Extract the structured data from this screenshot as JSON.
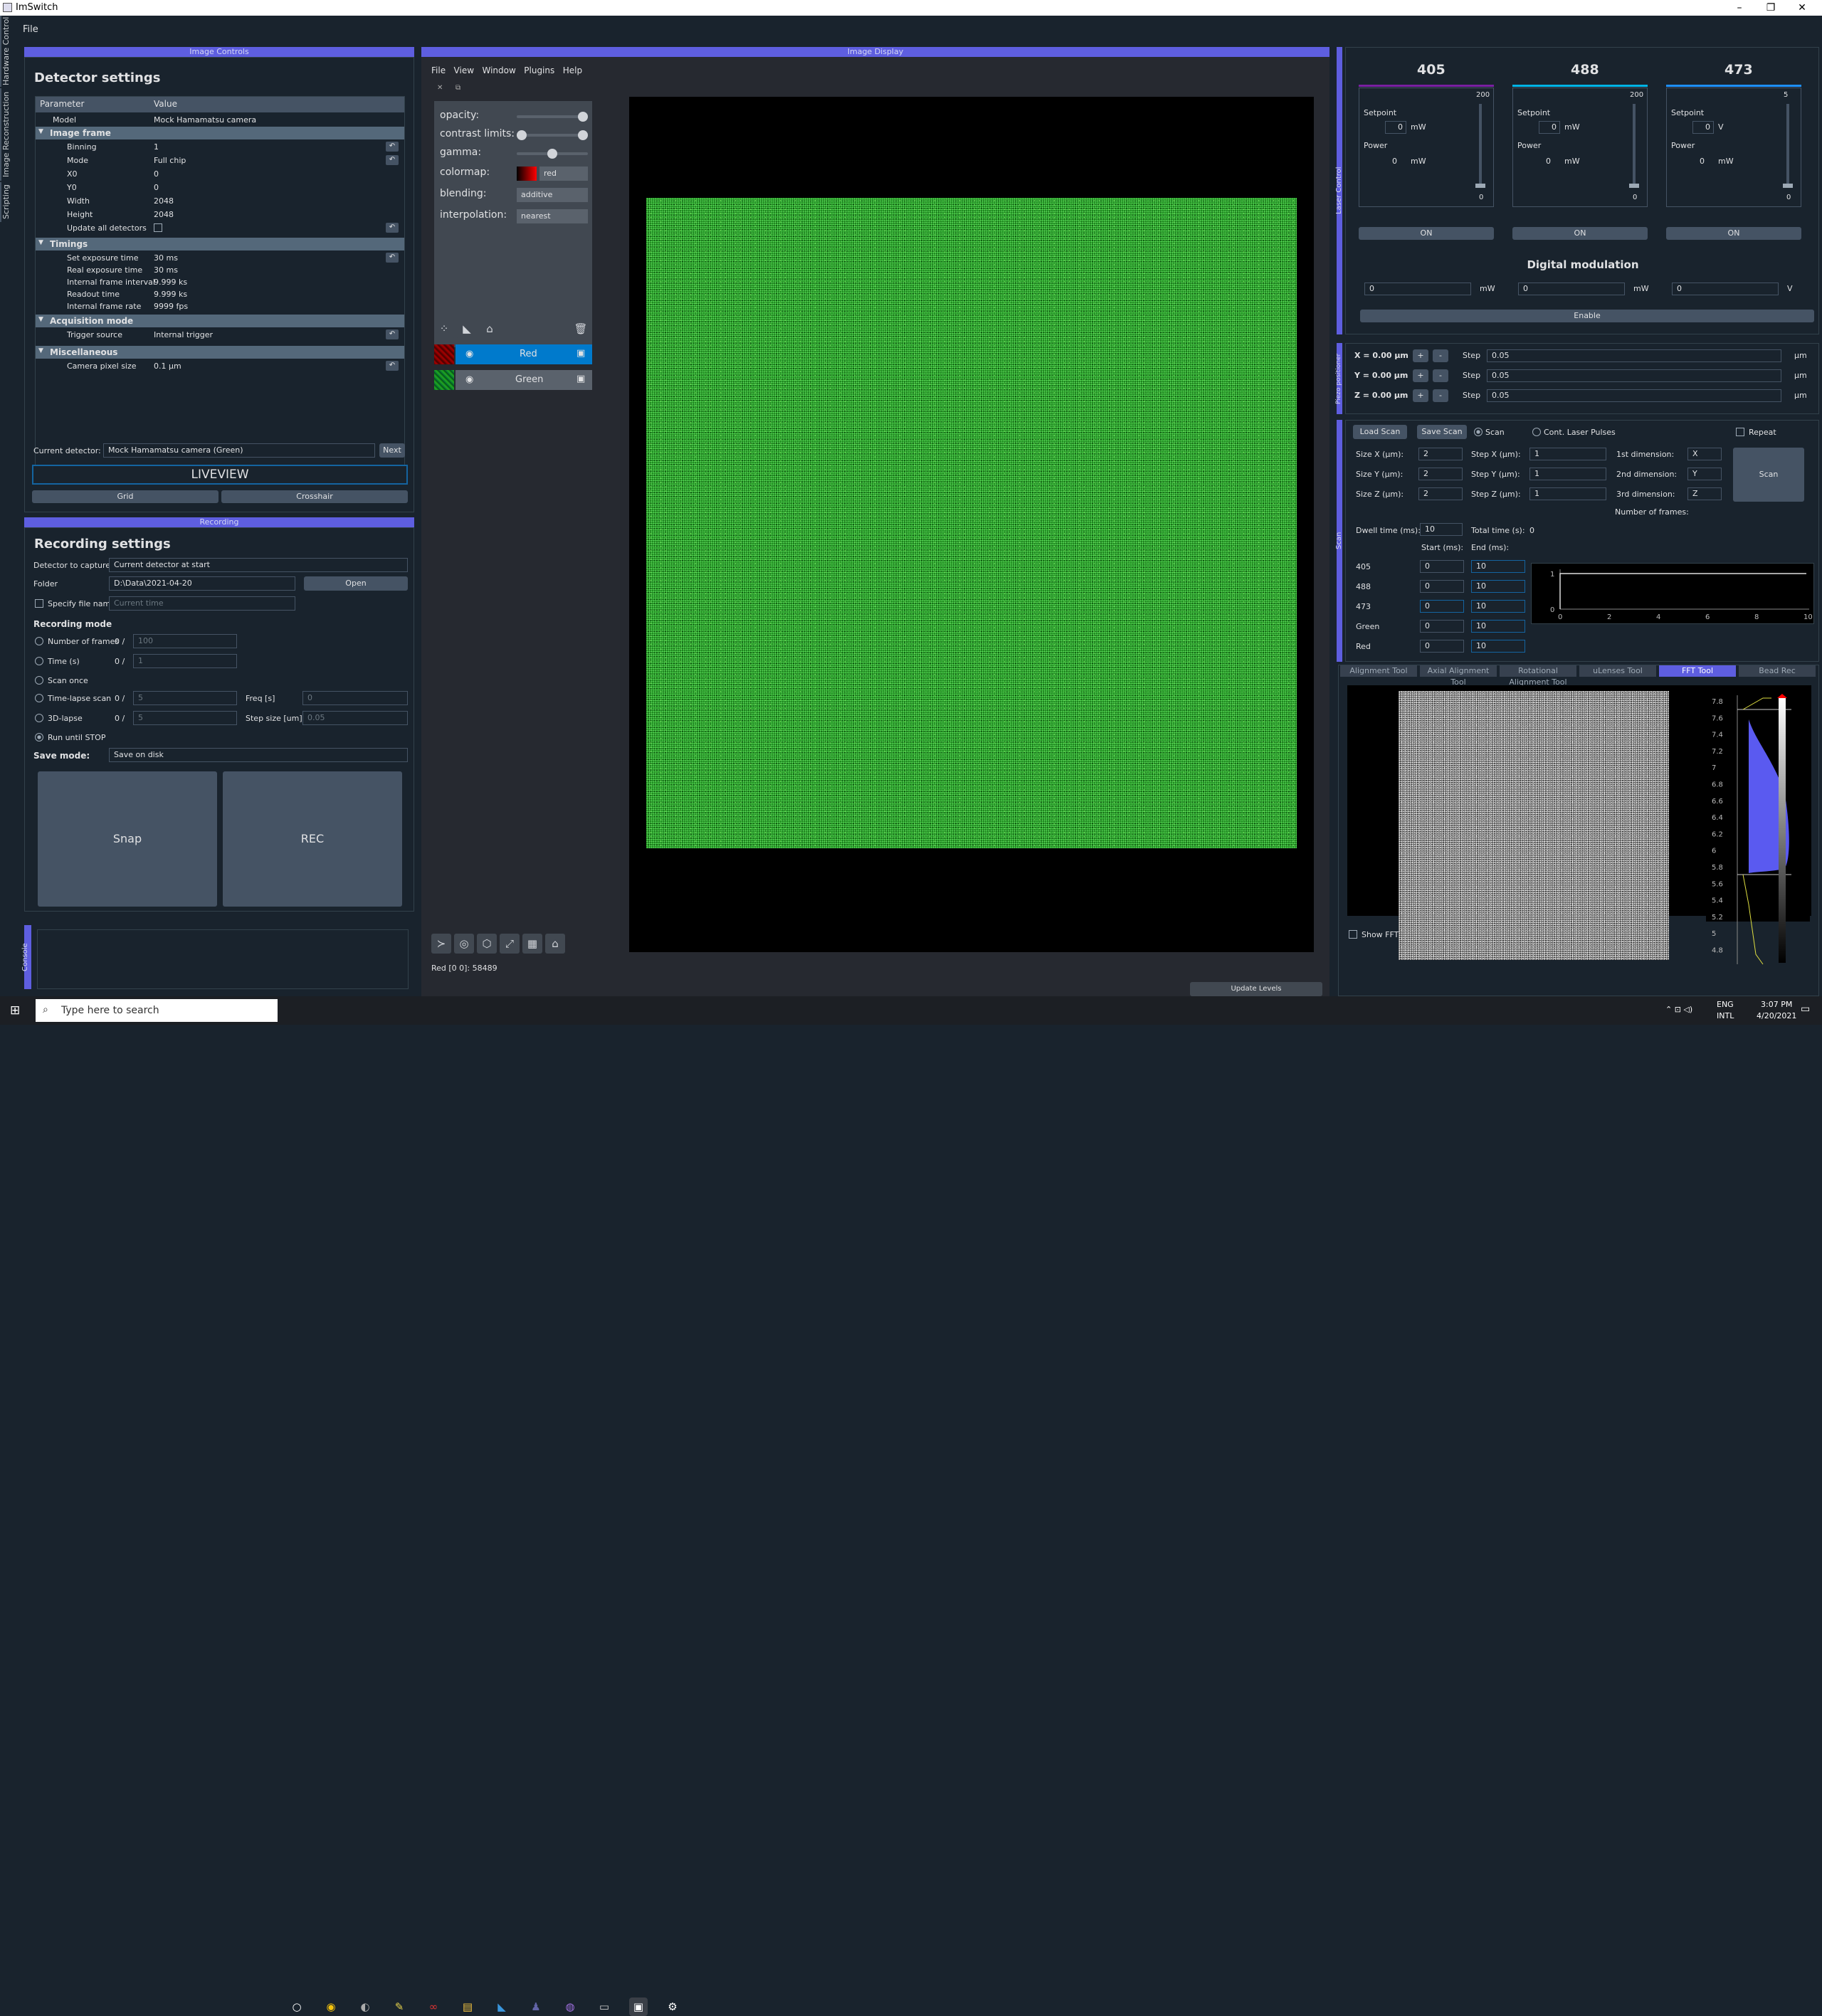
{
  "window": {
    "title": "ImSwitch",
    "menu": "File",
    "minimize": "–",
    "maximize": "❐",
    "close": "✕"
  },
  "side_tabs": [
    "Hardware Control",
    "Image Reconstruction",
    "Scripting"
  ],
  "image_controls": {
    "dock_title": "Image Controls",
    "title": "Detector settings",
    "columns": [
      "Parameter",
      "Value"
    ],
    "model": {
      "label": "Model",
      "value": "Mock Hamamatsu camera"
    },
    "groups": {
      "image_frame": "Image frame",
      "timings": "Timings",
      "acquisition": "Acquisition mode",
      "misc": "Miscellaneous"
    },
    "image_frame_rows": [
      {
        "label": "Binning",
        "value": "1"
      },
      {
        "label": "Mode",
        "value": "Full chip"
      },
      {
        "label": "X0",
        "value": "0"
      },
      {
        "label": "Y0",
        "value": "0"
      },
      {
        "label": "Width",
        "value": "2048"
      },
      {
        "label": "Height",
        "value": "2048"
      },
      {
        "label": "Update all detectors",
        "value": ""
      }
    ],
    "timing_rows": [
      {
        "label": "Set exposure time",
        "value": "30 ms"
      },
      {
        "label": "Real exposure time",
        "value": "30 ms"
      },
      {
        "label": "Internal frame interval",
        "value": "9.999 ks"
      },
      {
        "label": "Readout time",
        "value": "9.999 ks"
      },
      {
        "label": "Internal frame rate",
        "value": "9999 fps"
      }
    ],
    "trigger": {
      "label": "Trigger source",
      "value": "Internal trigger"
    },
    "pixel": {
      "label": "Camera pixel size",
      "value": "0.1 µm"
    },
    "current_detector_label": "Current detector:",
    "current_detector": "Mock Hamamatsu camera (Green)",
    "next": "Next",
    "liveview": "LIVEVIEW",
    "grid": "Grid",
    "crosshair": "Crosshair",
    "reset": "↶"
  },
  "recording": {
    "dock_title": "Recording",
    "title": "Recording settings",
    "detector_label": "Detector to capture",
    "detector_value": "Current detector at start",
    "folder_label": "Folder",
    "folder_value": "D:\\Data\\2021-04-20",
    "open": "Open",
    "specify_label": "Specify file name",
    "specify_placeholder": "Current time",
    "mode_title": "Recording mode",
    "nframes": "Number of frames",
    "nframes_count": "0 /",
    "nframes_val": "100",
    "time": "Time (s)",
    "time_count": "0 /",
    "time_val": "1",
    "scan_once": "Scan once",
    "timelapse": "Time-lapse scan",
    "tl_count": "0 /",
    "tl_val": "5",
    "freq_label": "Freq [s]",
    "freq_val": "0",
    "lapse3d": "3D-lapse",
    "l3_count": "0 /",
    "l3_val": "5",
    "step_label": "Step size [um]",
    "step_val": "0.05",
    "run_until_stop": "Run until STOP",
    "save_mode_label": "Save mode:",
    "save_mode_value": "Save on disk",
    "snap": "Snap",
    "rec": "REC"
  },
  "console_label": "Console",
  "image_display": {
    "dock_title": "Image Display",
    "menu": [
      "File",
      "View",
      "Window",
      "Plugins",
      "Help"
    ],
    "layer_controls": {
      "opacity": "opacity:",
      "contrast": "contrast limits:",
      "gamma": "gamma:",
      "colormap": "colormap:",
      "colormap_value": "red",
      "blending": "blending:",
      "blending_value": "additive",
      "interpolation": "interpolation:",
      "interpolation_value": "nearest",
      "opacity_level": 1.0,
      "gamma_level": 0.5,
      "contrast_range": [
        0.0,
        1.0
      ]
    },
    "layers": [
      {
        "name": "Red",
        "selected": true
      },
      {
        "name": "Green",
        "selected": false
      }
    ],
    "status": "Red [0 0]: 58489",
    "update_levels": "Update Levels"
  },
  "lasers": {
    "dock_title": "Laser Control",
    "channels": [
      {
        "name": "405",
        "color": "#7a1fa2",
        "max": "200",
        "min": "0",
        "setpoint": "0",
        "unit": "mW",
        "power": "0",
        "power_unit": "mW",
        "on": "ON",
        "mod": "0",
        "mod_unit": "mW"
      },
      {
        "name": "488",
        "color": "#00b4e6",
        "max": "200",
        "min": "0",
        "setpoint": "0",
        "unit": "mW",
        "power": "0",
        "power_unit": "mW",
        "on": "ON",
        "mod": "0",
        "mod_unit": "mW"
      },
      {
        "name": "473",
        "color": "#1e90ff",
        "max": "5",
        "min": "0",
        "setpoint": "0",
        "unit": "V",
        "power": "0",
        "power_unit": "mW",
        "on": "ON",
        "mod": "0",
        "mod_unit": "V"
      }
    ],
    "setpoint_label": "Setpoint",
    "power_label": "Power",
    "digital_modulation": "Digital modulation",
    "enable": "Enable"
  },
  "piezo": {
    "dock_title": "Piezo positioner",
    "axes": [
      {
        "label": "X = 0.00 µm",
        "step": "0.05"
      },
      {
        "label": "Y = 0.00 µm",
        "step": "0.05"
      },
      {
        "label": "Z = 0.00 µm",
        "step": "0.05"
      }
    ],
    "plus": "+",
    "minus": "-",
    "step_label": "Step",
    "unit": "µm"
  },
  "scan": {
    "dock_title": "Scan",
    "load": "Load Scan",
    "save": "Save Scan",
    "scan_radio": "Scan",
    "cont_radio": "Cont. Laser Pulses",
    "repeat": "Repeat",
    "rows": [
      {
        "size_label": "Size X (µm):",
        "size": "2",
        "step_label": "Step X (µm):",
        "step": "1",
        "dim_label": "1st dimension:",
        "dim": "X"
      },
      {
        "size_label": "Size Y (µm):",
        "size": "2",
        "step_label": "Step Y (µm):",
        "step": "1",
        "dim_label": "2nd dimension:",
        "dim": "Y"
      },
      {
        "size_label": "Size Z (µm):",
        "size": "2",
        "step_label": "Step Z (µm):",
        "step": "1",
        "dim_label": "3rd dimension:",
        "dim": "Z"
      }
    ],
    "scan_button": "Scan",
    "nframes_label": "Number of frames:",
    "dwell_label": "Dwell time (ms):",
    "dwell": "10",
    "total_label": "Total time (s):",
    "total": "0",
    "start_label": "Start (ms):",
    "end_label": "End (ms):",
    "signals": [
      {
        "name": "405",
        "start": "0",
        "end": "10"
      },
      {
        "name": "488",
        "start": "0",
        "end": "10"
      },
      {
        "name": "473",
        "start": "0",
        "end": "10"
      },
      {
        "name": "Green",
        "start": "0",
        "end": "10"
      },
      {
        "name": "Red",
        "start": "0",
        "end": "10"
      }
    ],
    "plot": {
      "yticks": [
        "1",
        "0"
      ],
      "xticks": [
        "0",
        "2",
        "4",
        "6",
        "8",
        "10"
      ]
    }
  },
  "tools": {
    "tabs": [
      "Alignment Tool",
      "Axial Alignment Tool",
      "Rotational Alignment Tool",
      "uLenses Tool",
      "FFT Tool",
      "Bead Rec"
    ],
    "selected": 4,
    "hist_ticks": [
      "7.8",
      "7.6",
      "7.4",
      "7.2",
      "7",
      "6.8",
      "6.6",
      "6.4",
      "6.2",
      "6",
      "5.8",
      "5.6",
      "5.4",
      "5.2",
      "5",
      "4.8"
    ],
    "show_fft": "Show FFT"
  },
  "taskbar": {
    "search": "Type here to search",
    "lang1": "ENG",
    "lang2": "INTL",
    "time": "3:07 PM",
    "date": "4/20/2021"
  }
}
